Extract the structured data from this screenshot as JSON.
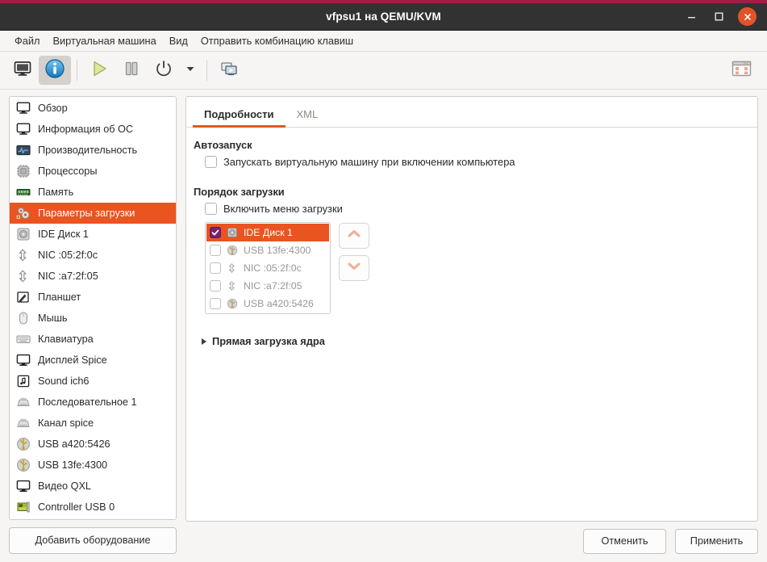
{
  "window": {
    "title": "vfpsu1 на QEMU/KVM",
    "minimize_label": "Свернуть",
    "maximize_label": "Развернуть",
    "close_label": "Закрыть",
    "accent_orange": "#e95420",
    "accent_purple": "#77216f",
    "titlebar_bg": "#323232",
    "topstrip": "#a01e45"
  },
  "menubar": {
    "items": [
      {
        "label": "Файл"
      },
      {
        "label": "Виртуальная машина"
      },
      {
        "label": "Вид"
      },
      {
        "label": "Отправить комбинацию клавиш"
      }
    ]
  },
  "toolbar": {
    "buttons": [
      {
        "name": "console-view-button",
        "icon": "monitor-icon",
        "active": false
      },
      {
        "name": "details-view-button",
        "icon": "info-icon",
        "active": true
      },
      {
        "name": "run-button",
        "icon": "play-icon",
        "active": false
      },
      {
        "name": "pause-button",
        "icon": "pause-icon",
        "active": false
      },
      {
        "name": "shutdown-button",
        "icon": "power-icon",
        "active": false
      },
      {
        "name": "shutdown-menu-button",
        "icon": "chevron-down-icon",
        "active": false
      },
      {
        "name": "snapshots-button",
        "icon": "screens-icon",
        "active": false
      }
    ],
    "fullscreen": {
      "name": "fullscreen-button",
      "icon": "fullscreen-icon"
    }
  },
  "sidebar": {
    "items": [
      {
        "label": "Обзор",
        "icon": "monitor-icon",
        "selected": false
      },
      {
        "label": "Информация об ОС",
        "icon": "monitor-icon",
        "selected": false
      },
      {
        "label": "Производительность",
        "icon": "chart-icon",
        "selected": false
      },
      {
        "label": "Процессоры",
        "icon": "cpu-icon",
        "selected": false
      },
      {
        "label": "Память",
        "icon": "memory-icon",
        "selected": false
      },
      {
        "label": "Параметры загрузки",
        "icon": "boot-gears-icon",
        "selected": true
      },
      {
        "label": "IDE Диск 1",
        "icon": "disk-icon",
        "selected": false
      },
      {
        "label": "NIC :05:2f:0c",
        "icon": "network-icon",
        "selected": false
      },
      {
        "label": "NIC :a7:2f:05",
        "icon": "network-icon",
        "selected": false
      },
      {
        "label": "Планшет",
        "icon": "tablet-icon",
        "selected": false
      },
      {
        "label": "Мышь",
        "icon": "mouse-icon",
        "selected": false
      },
      {
        "label": "Клавиатура",
        "icon": "keyboard-icon",
        "selected": false
      },
      {
        "label": "Дисплей Spice",
        "icon": "display-icon",
        "selected": false
      },
      {
        "label": "Sound ich6",
        "icon": "sound-icon",
        "selected": false
      },
      {
        "label": "Последовательное 1",
        "icon": "serial-icon",
        "selected": false
      },
      {
        "label": "Канал spice",
        "icon": "serial-icon",
        "selected": false
      },
      {
        "label": "USB a420:5426",
        "icon": "usb-icon",
        "selected": false
      },
      {
        "label": "USB 13fe:4300",
        "icon": "usb-icon",
        "selected": false
      },
      {
        "label": "Видео QXL",
        "icon": "display-icon",
        "selected": false
      },
      {
        "label": "Controller USB 0",
        "icon": "controller-icon",
        "selected": false
      }
    ],
    "add_hardware_label": "Добавить оборудование"
  },
  "main": {
    "tabs": [
      {
        "label": "Подробности",
        "active": true
      },
      {
        "label": "XML",
        "active": false
      }
    ],
    "autostart": {
      "title": "Автозапуск",
      "checkbox_label": "Запускать виртуальную машину при включении компьютера",
      "checked": false
    },
    "boot_order": {
      "title": "Порядок загрузки",
      "enable_menu_label": "Включить меню загрузки",
      "enable_menu_checked": false,
      "devices": [
        {
          "label": "IDE Диск 1",
          "icon": "disk-icon",
          "checked": true,
          "selected": true
        },
        {
          "label": "USB 13fe:4300",
          "icon": "usb-icon",
          "checked": false,
          "selected": false
        },
        {
          "label": "NIC :05:2f:0c",
          "icon": "network-icon",
          "checked": false,
          "selected": false
        },
        {
          "label": "NIC :a7:2f:05",
          "icon": "network-icon",
          "checked": false,
          "selected": false
        },
        {
          "label": "USB a420:5426",
          "icon": "usb-icon",
          "checked": false,
          "selected": false
        }
      ],
      "move_up_label": "Вверх",
      "move_down_label": "Вниз"
    },
    "direct_kernel": {
      "label": "Прямая загрузка ядра",
      "expanded": false
    }
  },
  "footer": {
    "cancel_label": "Отменить",
    "apply_label": "Применить"
  }
}
